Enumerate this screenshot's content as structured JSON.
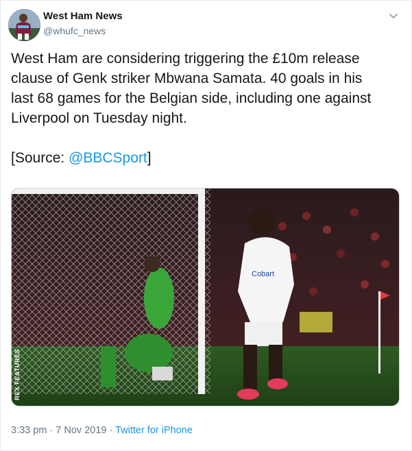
{
  "account": {
    "name": "West Ham News",
    "handle": "@whufc_news",
    "avatar_icon": "player-avatar"
  },
  "tweet": {
    "lines": [
      "West Ham are considering triggering the £10m release",
      "clause of Genk striker Mbwana Samata. 40 goals in his",
      "last 68 games for the Belgian side, including one against",
      "Liverpool on Tuesday night."
    ],
    "source_prefix": "[Source: ",
    "source_link": "@BBCSport",
    "source_suffix": "]"
  },
  "media": {
    "image_credit": "REX FEATURES",
    "shirt_text": "Cobart"
  },
  "meta": {
    "time": "3:33 pm",
    "separator1": " · ",
    "date": "7 Nov 2019",
    "separator2": " · ",
    "source_app": "Twitter for iPhone"
  },
  "colors": {
    "link": "#1b95e0",
    "secondary_text": "#657786",
    "primary_text": "#14171a"
  },
  "icons": {
    "menu": "chevron-down-icon"
  }
}
